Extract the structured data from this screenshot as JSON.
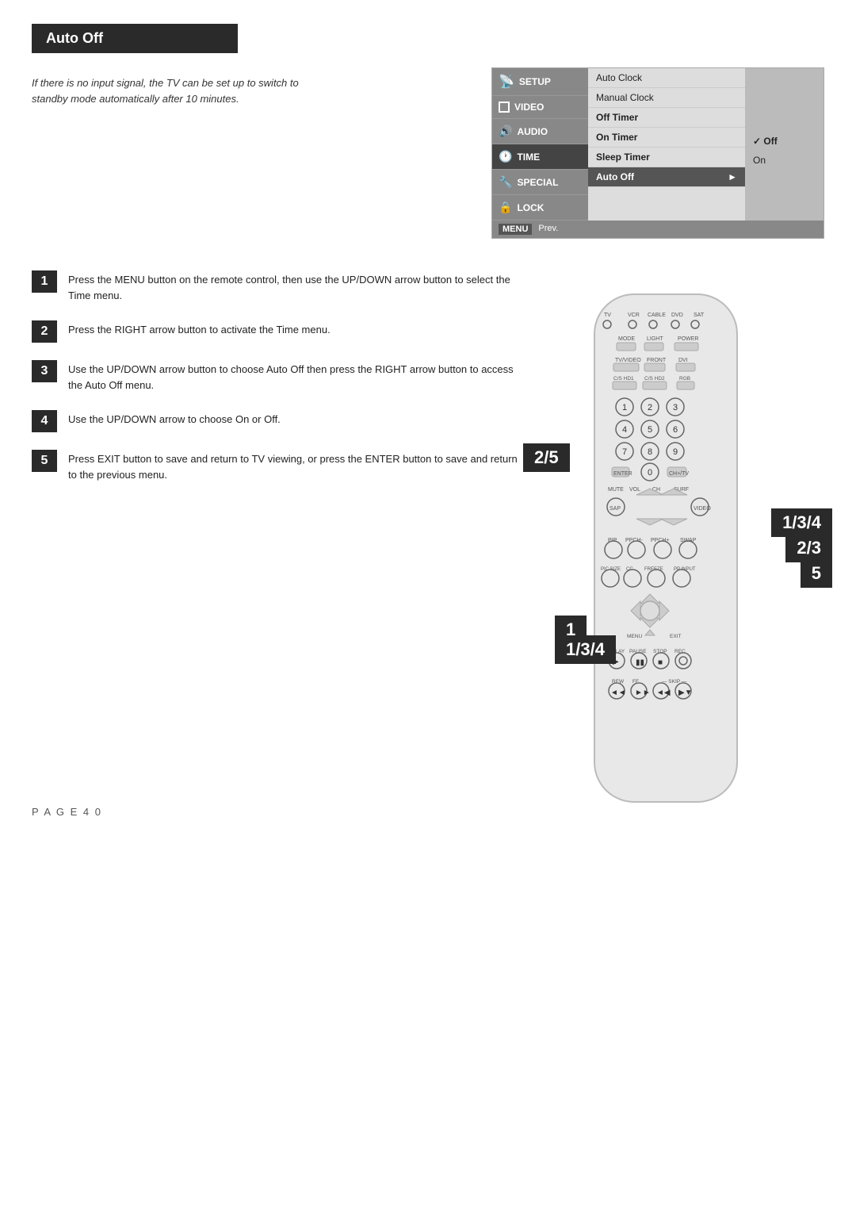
{
  "page": {
    "title": "Auto Off",
    "intro": "If there is no input signal, the TV can be set up to switch to standby mode automatically after 10 minutes.",
    "page_number": "P A G E   4 0"
  },
  "menu": {
    "left_items": [
      {
        "label": "SETUP",
        "icon": "signal",
        "active": false
      },
      {
        "label": "VIDEO",
        "icon": "square",
        "active": false
      },
      {
        "label": "AUDIO",
        "icon": "speaker",
        "active": false
      },
      {
        "label": "TIME",
        "icon": "clock",
        "active": true
      },
      {
        "label": "SPECIAL",
        "icon": "special",
        "active": false
      },
      {
        "label": "LOCK",
        "icon": "lock",
        "active": false
      }
    ],
    "right_items": [
      {
        "label": "Auto Clock",
        "selected": false
      },
      {
        "label": "Manual Clock",
        "selected": false
      },
      {
        "label": "Off Timer",
        "selected": false,
        "bold": true
      },
      {
        "label": "On Timer",
        "selected": false,
        "bold": true
      },
      {
        "label": "Sleep Timer",
        "selected": false,
        "bold": true
      },
      {
        "label": "Auto Off",
        "selected": true,
        "has_arrow": true
      }
    ],
    "sub_items": [
      {
        "label": "✓ Off",
        "checked": true
      },
      {
        "label": "On",
        "checked": false
      }
    ],
    "bottom": {
      "key": "MENU",
      "label": "Prev."
    }
  },
  "steps": [
    {
      "num": "1",
      "text": "Press the MENU button on the remote control, then use the UP/DOWN arrow button to select the Time menu."
    },
    {
      "num": "2",
      "text": "Press the RIGHT arrow button to activate the Time menu."
    },
    {
      "num": "3",
      "text": "Use the UP/DOWN arrow button to choose Auto Off then press the RIGHT arrow button to access the Auto Off menu."
    },
    {
      "num": "4",
      "text": "Use the UP/DOWN arrow to choose On or Off."
    },
    {
      "num": "5",
      "text": "Press EXIT button to save and return to TV viewing, or press the ENTER button to save and return to the previous menu."
    }
  ],
  "step_labels": {
    "label_25": "2/5",
    "label_134": "1/3/4",
    "label_23": "2/3",
    "label_5": "5",
    "label_1": "1",
    "label_134b": "1/3/4"
  }
}
